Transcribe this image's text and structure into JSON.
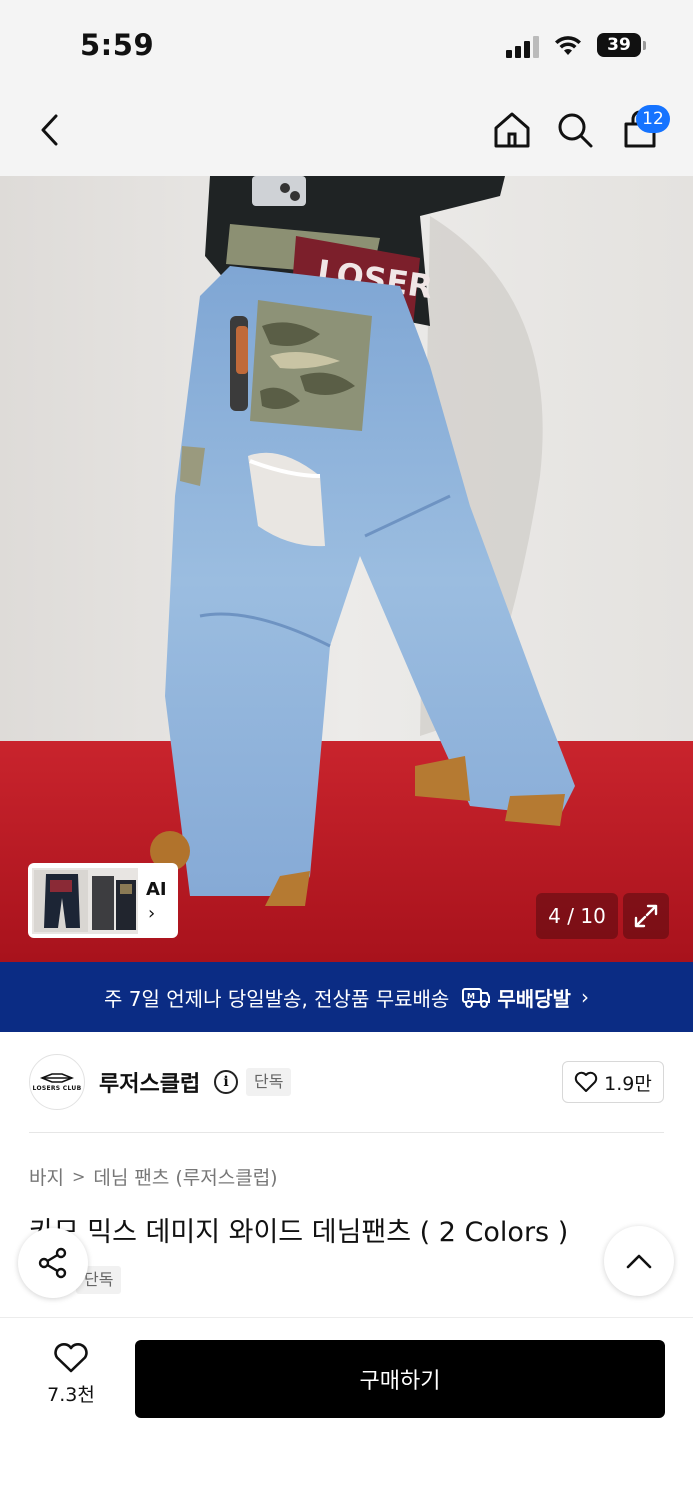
{
  "status_bar": {
    "time": "5:59",
    "battery": "39"
  },
  "header": {
    "cart_count": "12",
    "icons": [
      "back-icon",
      "home-icon",
      "search-icon",
      "cart-icon"
    ]
  },
  "image_viewer": {
    "ai_label": "AI",
    "counter": "4 / 10",
    "current_index": 4,
    "total": 10
  },
  "shipping_banner": {
    "text": "주 7일 언제나 당일발송, 전상품 무료배송",
    "badge": "무배당발"
  },
  "brand": {
    "name": "루저스클럽",
    "logo_text": "LOSERS CLUB",
    "exclusive_tag": "단독",
    "like_count": "1.9만"
  },
  "product": {
    "breadcrumb": [
      "바지",
      "데님 팬츠 (루저스클럽)"
    ],
    "title": "카모 믹스 데미지 와이드 데님팬츠 ( 2 Colors )",
    "exclusive_tag": "단독"
  },
  "bottom_bar": {
    "like_count": "7.3천",
    "buy_label": "구매하기"
  },
  "colors": {
    "accent_blue": "#1573ff",
    "banner_navy": "#0b2c84",
    "buy_button": "#000000"
  }
}
